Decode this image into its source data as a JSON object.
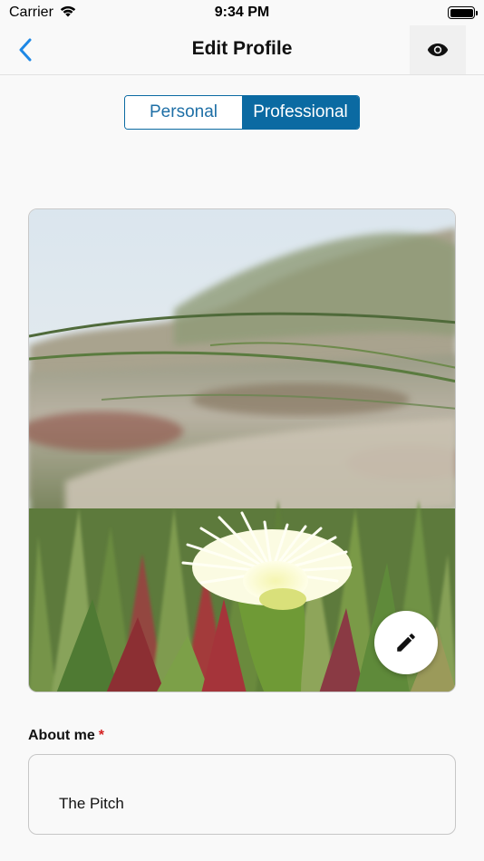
{
  "status_bar": {
    "carrier": "Carrier",
    "time": "9:34 PM",
    "battery_level_pct": 100
  },
  "nav": {
    "title": "Edit Profile",
    "back_icon": "chevron-left-icon",
    "preview_icon": "eye-icon"
  },
  "segments": {
    "personal_label": "Personal",
    "professional_label": "Professional",
    "selected": "Professional"
  },
  "photo": {
    "edit_icon": "pencil-icon"
  },
  "about": {
    "label": "About me",
    "required_marker": "*",
    "value": "The Pitch"
  },
  "colors": {
    "accent": "#0b6aa2",
    "back_chevron": "#1e88e5",
    "required": "#d42020"
  }
}
